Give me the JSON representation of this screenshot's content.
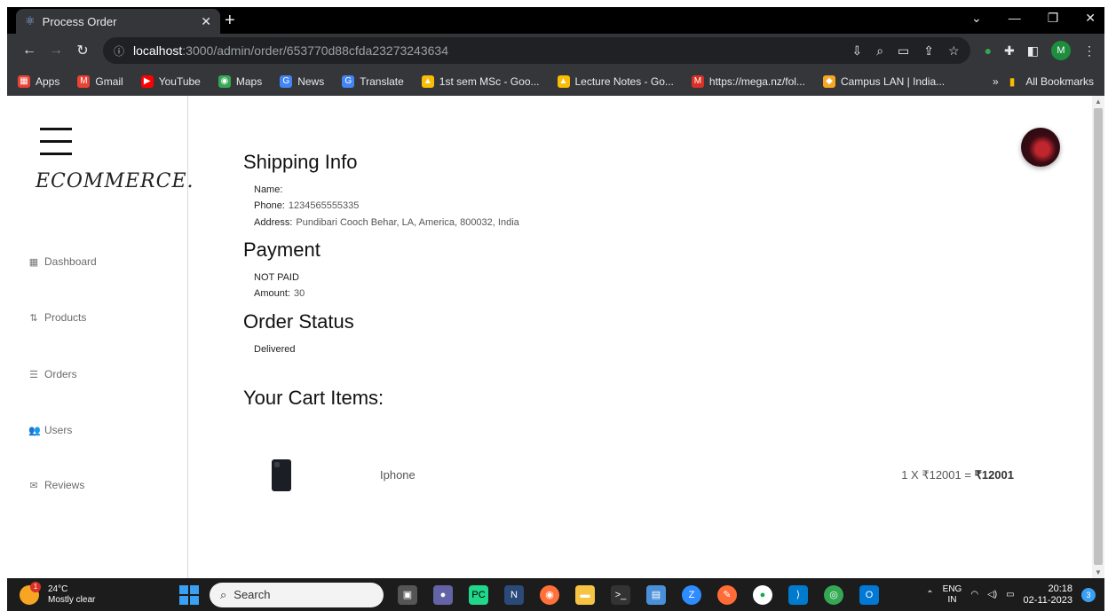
{
  "browser": {
    "tab_title": "Process Order",
    "tab_favicon": "⚛",
    "tab_close": "✕",
    "new_tab": "+",
    "window_controls": [
      "⌄",
      "—",
      "❐",
      "✕"
    ],
    "url_host": "localhost",
    "url_path": ":3000/admin/order/653770d88cfda23273243634",
    "omnibox_icons": [
      "⇩",
      "⌕",
      "▭",
      "⇪",
      "☆"
    ],
    "profile_initial": "M",
    "bookmarks": [
      {
        "label": "Apps",
        "color": "#ea4335"
      },
      {
        "label": "Gmail",
        "color": "#ea4335"
      },
      {
        "label": "YouTube",
        "color": "#ff0000"
      },
      {
        "label": "Maps",
        "color": "#34a853"
      },
      {
        "label": "News",
        "color": "#4285f4"
      },
      {
        "label": "Translate",
        "color": "#4285f4"
      },
      {
        "label": "1st sem MSc - Goo...",
        "color": "#fbbc04"
      },
      {
        "label": "Lecture Notes - Go...",
        "color": "#fbbc04"
      },
      {
        "label": "https://mega.nz/fol...",
        "color": "#d93025"
      },
      {
        "label": "Campus LAN | India...",
        "color": "#f6a623"
      }
    ],
    "bookmarks_more": "»",
    "all_bookmarks": "All Bookmarks"
  },
  "sidebar": {
    "logo": "ECOMMERCE.",
    "items": [
      {
        "label": "Dashboard",
        "icon": "▦"
      },
      {
        "label": "Products",
        "icon": "⇅"
      },
      {
        "label": "Orders",
        "icon": "☰"
      },
      {
        "label": "Users",
        "icon": "👥"
      },
      {
        "label": "Reviews",
        "icon": "✉"
      }
    ]
  },
  "shipping": {
    "heading": "Shipping Info",
    "name_label": "Name:",
    "name_value": "",
    "phone_label": "Phone:",
    "phone_value": "1234565555335",
    "address_label": "Address:",
    "address_value": "Pundibari Cooch Behar, LA, America, 800032, India"
  },
  "payment": {
    "heading": "Payment",
    "status": "NOT PAID",
    "amount_label": "Amount:",
    "amount_value": "30"
  },
  "order_status": {
    "heading": "Order Status",
    "value": "Delivered"
  },
  "cart": {
    "heading": "Your Cart Items:",
    "items": [
      {
        "name": "Iphone",
        "qty_price": "1 X ₹12001 = ",
        "total": "₹12001"
      }
    ]
  },
  "taskbar": {
    "weather_temp": "24°C",
    "weather_desc": "Mostly clear",
    "weather_badge": "1",
    "search_placeholder": "Search",
    "lang_top": "ENG",
    "lang_bottom": "IN",
    "time": "20:18",
    "date": "02-11-2023",
    "notifications": "3"
  }
}
